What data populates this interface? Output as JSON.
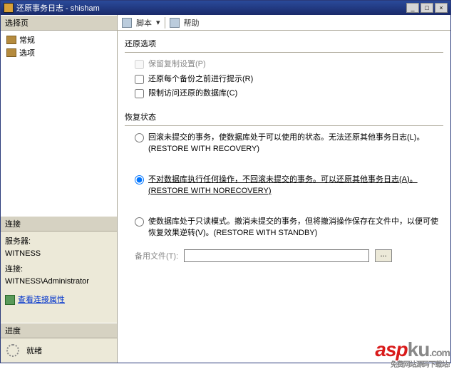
{
  "window": {
    "title": "还原事务日志 - shisham",
    "btn_min": "_",
    "btn_max": "□",
    "btn_close": "×"
  },
  "toolbar": {
    "script_label": "脚本",
    "help_label": "帮助"
  },
  "sidebar": {
    "select_header": "选择页",
    "items": [
      {
        "label": "常规"
      },
      {
        "label": "选项"
      }
    ],
    "conn_header": "连接",
    "server_label": "服务器:",
    "server_value": "WITNESS",
    "conn_label": "连接:",
    "conn_value": "WITNESS\\Administrator",
    "view_props": "查看连接属性",
    "progress_header": "进度",
    "progress_status": "就绪"
  },
  "options": {
    "restore_options_title": "还原选项",
    "keep_repl": "保留复制设置(P)",
    "prompt_each": "还原每个备份之前进行提示(R)",
    "restrict_access": "限制访问还原的数据库(C)",
    "recovery_state_title": "恢复状态",
    "radio1": "回滚未提交的事务，使数据库处于可以使用的状态。无法还原其他事务日志(L)。(RESTORE WITH RECOVERY)",
    "radio2": "不对数据库执行任何操作，不回滚未提交的事务。可以还原其他事务日志(A)。(RESTORE WITH NORECOVERY)",
    "radio3": "使数据库处于只读模式。撤消未提交的事务，但将撤消操作保存在文件中，以便可使恢复效果逆转(V)。(RESTORE WITH STANDBY)",
    "backup_file_label": "备用文件(T):",
    "browse_label": "..."
  },
  "watermark": {
    "brand_left": "asp",
    "brand_right": "ku",
    "dot": ".com",
    "tag": "免费网站源码下载站!"
  }
}
